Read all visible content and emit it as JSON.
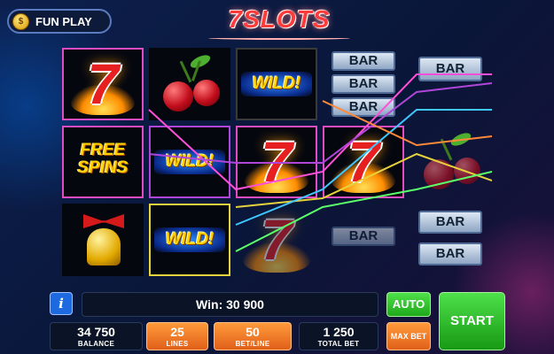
{
  "header": {
    "fun_play_label": "FUN PLAY",
    "coin_glyph": "$",
    "logo_text": "7SLOTS"
  },
  "reels": {
    "symbols": {
      "wild_text": "WILD!",
      "bar_text": "BAR",
      "free_spins_line1": "FREE",
      "free_spins_line2": "SPINS",
      "seven_text": "7"
    }
  },
  "bottom": {
    "win_text": "Win: 30 900",
    "balance": {
      "value": "34 750",
      "label": "BALANCE"
    },
    "lines": {
      "value": "25",
      "label": "LINES"
    },
    "bet_line": {
      "value": "50",
      "label": "BET/LINE"
    },
    "total_bet": {
      "value": "1 250",
      "label": "TOTAL BET"
    },
    "auto_label": "AUTO",
    "max_bet_label": "MAX BET",
    "start_label": "START",
    "info_glyph": "i"
  },
  "colors": {
    "accent_green": "#1ea81a",
    "accent_orange": "#e0601a",
    "frame_pink": "#e24cc2",
    "frame_yellow": "#e6d23c"
  }
}
